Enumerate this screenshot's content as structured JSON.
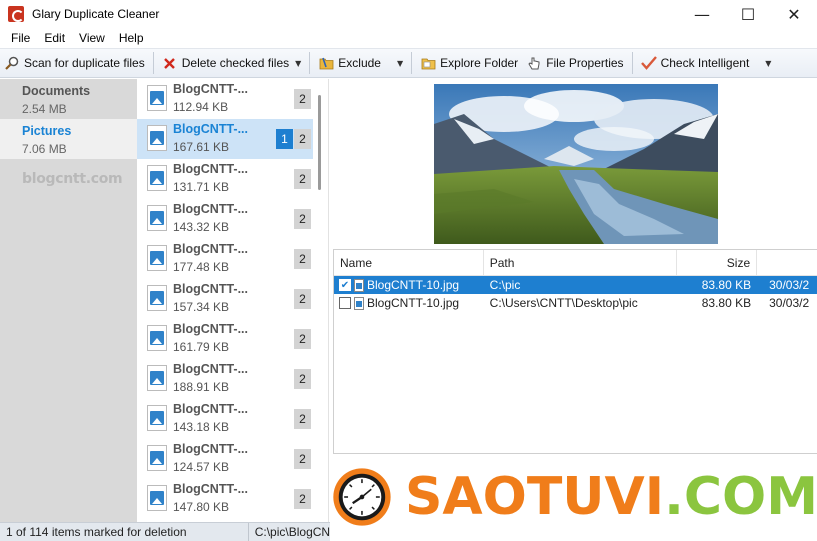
{
  "window": {
    "title": "Glary Duplicate Cleaner",
    "minimize": "—",
    "maximize": "☐",
    "close": "✕"
  },
  "menu": [
    "File",
    "Edit",
    "View",
    "Help"
  ],
  "toolbar": {
    "scan": "Scan for duplicate files",
    "delete": "Delete checked files",
    "exclude": "Exclude",
    "explore": "Explore Folder",
    "properties": "File Properties",
    "check": "Check Intelligent",
    "dropdown": "▼"
  },
  "categories": [
    {
      "name": "Documents",
      "size": "2.54 MB",
      "selected": false
    },
    {
      "name": "Pictures",
      "size": "7.06 MB",
      "selected": true
    }
  ],
  "category_watermark": "blogcntt.com",
  "files": [
    {
      "name": "BlogCNTT-...",
      "size": "112.94 KB",
      "count": "2",
      "mark": ""
    },
    {
      "name": "BlogCNTT-...",
      "size": "167.61 KB",
      "count": "2",
      "mark": "1"
    },
    {
      "name": "BlogCNTT-...",
      "size": "131.71 KB",
      "count": "2",
      "mark": ""
    },
    {
      "name": "BlogCNTT-...",
      "size": "143.32 KB",
      "count": "2",
      "mark": ""
    },
    {
      "name": "BlogCNTT-...",
      "size": "177.48 KB",
      "count": "2",
      "mark": ""
    },
    {
      "name": "BlogCNTT-...",
      "size": "157.34 KB",
      "count": "2",
      "mark": ""
    },
    {
      "name": "BlogCNTT-...",
      "size": "161.79 KB",
      "count": "2",
      "mark": ""
    },
    {
      "name": "BlogCNTT-...",
      "size": "188.91 KB",
      "count": "2",
      "mark": ""
    },
    {
      "name": "BlogCNTT-...",
      "size": "143.18 KB",
      "count": "2",
      "mark": ""
    },
    {
      "name": "BlogCNTT-...",
      "size": "124.57 KB",
      "count": "2",
      "mark": ""
    },
    {
      "name": "BlogCNTT-...",
      "size": "147.80 KB",
      "count": "2",
      "mark": ""
    }
  ],
  "selected_file_index": 1,
  "details": {
    "columns": {
      "name": "Name",
      "path": "Path",
      "size": "Size",
      "date": ""
    },
    "rows": [
      {
        "name": "BlogCNTT-10.jpg",
        "path": "C:\\pic",
        "size": "83.80 KB",
        "date": "30/03/2",
        "checked": true,
        "selected": true
      },
      {
        "name": "BlogCNTT-10.jpg",
        "path": "C:\\Users\\CNTT\\Desktop\\pic",
        "size": "83.80 KB",
        "date": "30/03/2",
        "checked": false,
        "selected": false
      }
    ]
  },
  "logo": {
    "text_main": "SAOTUVI",
    "text_ext": ".COM"
  },
  "status": {
    "marked": "1 of 114 items marked for deletion",
    "path": "C:\\pic\\BlogCN"
  },
  "colors": {
    "accent": "#1e7fd0",
    "logo_orange": "#f07d1a",
    "logo_green": "#8bc53f"
  }
}
